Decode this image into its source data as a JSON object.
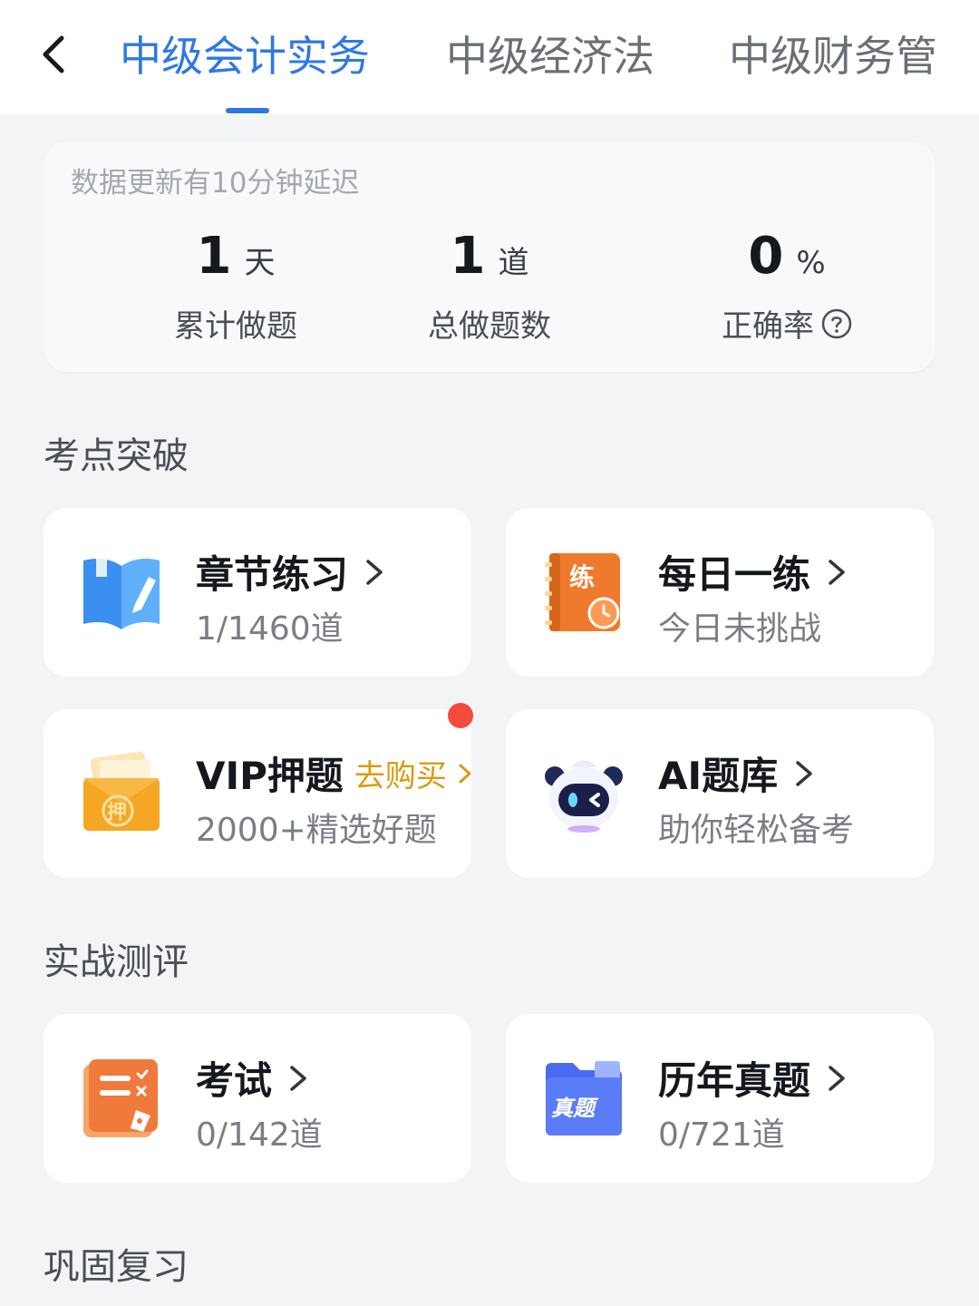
{
  "tabs": [
    {
      "label": "中级会计实务",
      "active": true
    },
    {
      "label": "中级经济法",
      "active": false
    },
    {
      "label": "中级财务管",
      "active": false
    }
  ],
  "stats": {
    "note": "数据更新有10分钟延迟",
    "items": [
      {
        "value": "1",
        "unit": "天",
        "label": "累计做题"
      },
      {
        "value": "1",
        "unit": "道",
        "label": "总做题数"
      },
      {
        "value": "0",
        "unit": "%",
        "label": "正确率"
      }
    ]
  },
  "sections": {
    "breakthrough": "考点突破",
    "assessment": "实战测评",
    "review": "巩固复习"
  },
  "cards": {
    "chapter": {
      "title": "章节练习",
      "sub": "1/1460道",
      "icon": "book-icon"
    },
    "daily": {
      "title": "每日一练",
      "sub": "今日未挑战",
      "icon": "daily-practice-icon",
      "icon_text": "练"
    },
    "vip": {
      "title": "VIP押题",
      "buy": "去购买",
      "sub": "2000+精选好题",
      "icon": "vip-envelope-icon",
      "icon_text": "押"
    },
    "ai": {
      "title": "AI题库",
      "sub": "助你轻松备考",
      "icon": "ai-robot-icon"
    },
    "exam": {
      "title": "考试",
      "sub": "0/142道",
      "icon": "exam-paper-icon"
    },
    "past": {
      "title": "历年真题",
      "sub": "0/721道",
      "icon": "past-papers-folder-icon",
      "icon_text": "真题"
    }
  },
  "colors": {
    "accent": "#2e78e6",
    "buy": "#d99a10",
    "badge": "#f24a3c",
    "background": "#f3f4f6"
  }
}
